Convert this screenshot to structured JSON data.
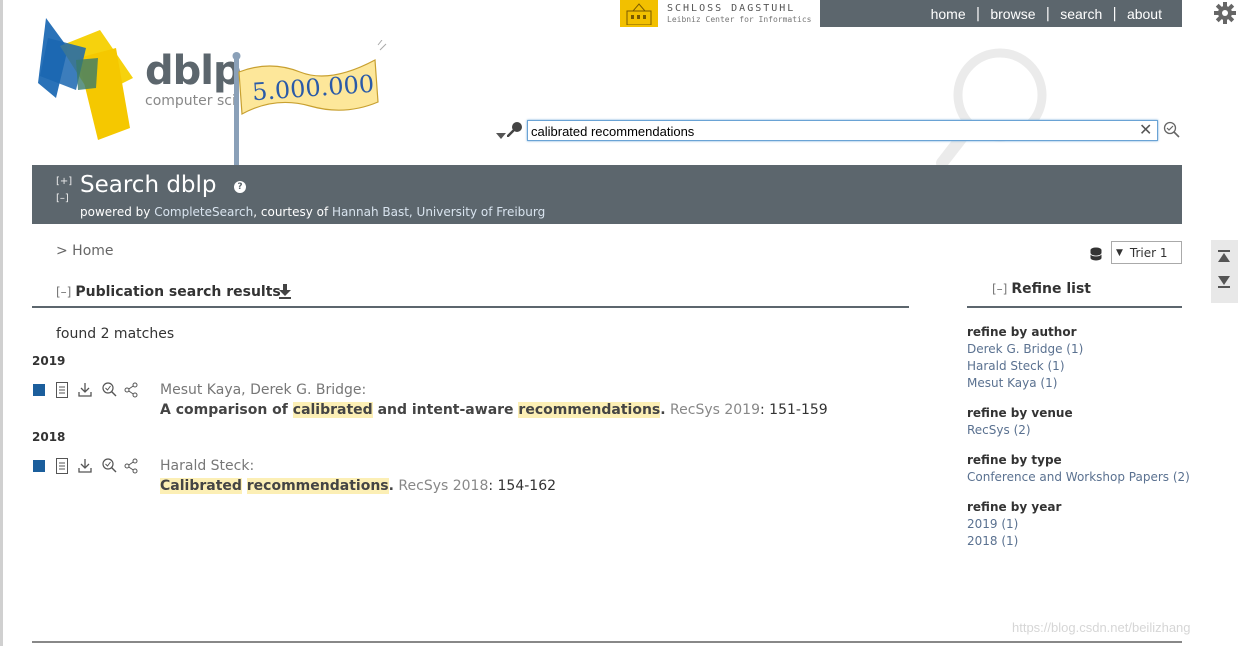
{
  "top": {
    "dagstuhl_title": "SCHLOSS DAGSTUHL",
    "dagstuhl_sub": "Leibniz Center for Informatics",
    "nav": [
      "home",
      "browse",
      "search",
      "about"
    ]
  },
  "logo": {
    "name": "dblp",
    "tagline": "computer sci",
    "flag_text": "5.000.000"
  },
  "search": {
    "value": "calibrated recommendations",
    "clear_symbol": "✕"
  },
  "header": {
    "toggle_expand": "[+]",
    "toggle_collapse": "[–]",
    "title": "Search dblp",
    "help_symbol": "?",
    "powered_prefix": "powered by ",
    "powered_engine": "CompleteSearch",
    "powered_mid": ", courtesy of ",
    "powered_person": "Hannah Bast, University of Freiburg"
  },
  "breadcrumb": "> Home",
  "mirror": "Trier 1",
  "results": {
    "toggle": "[–]",
    "heading": "Publication search results",
    "found": "found 2 matches",
    "groups": [
      {
        "year": "2019",
        "authors": "Mesut Kaya, Derek G. Bridge:",
        "title_parts": [
          "A comparison of ",
          "calibrated",
          " and intent-aware ",
          "recommendations",
          "."
        ],
        "venue": " RecSys 2019",
        "pages": ": 151-159"
      },
      {
        "year": "2018",
        "authors": "Harald Steck:",
        "title_parts": [
          "",
          "Calibrated",
          " ",
          "recommendations",
          "."
        ],
        "venue": " RecSys 2018",
        "pages": ": 154-162"
      }
    ]
  },
  "refine": {
    "toggle": "[–]",
    "heading": "Refine list",
    "groups": [
      {
        "title": "refine by author",
        "items": [
          "Derek G. Bridge (1)",
          "Harald Steck (1)",
          "Mesut Kaya (1)"
        ]
      },
      {
        "title": "refine by venue",
        "items": [
          "RecSys (2)"
        ]
      },
      {
        "title": "refine by type",
        "items": [
          "Conference and Workshop Papers (2)"
        ]
      },
      {
        "title": "refine by year",
        "items": [
          "2019 (1)",
          "2018 (1)"
        ]
      }
    ]
  },
  "watermark": "https://blog.csdn.net/beilizhang",
  "colors": {
    "bar": "#5c666d",
    "highlight": "#fcefb5",
    "link": "#5a7190",
    "dagstuhl": "#f2c000"
  }
}
